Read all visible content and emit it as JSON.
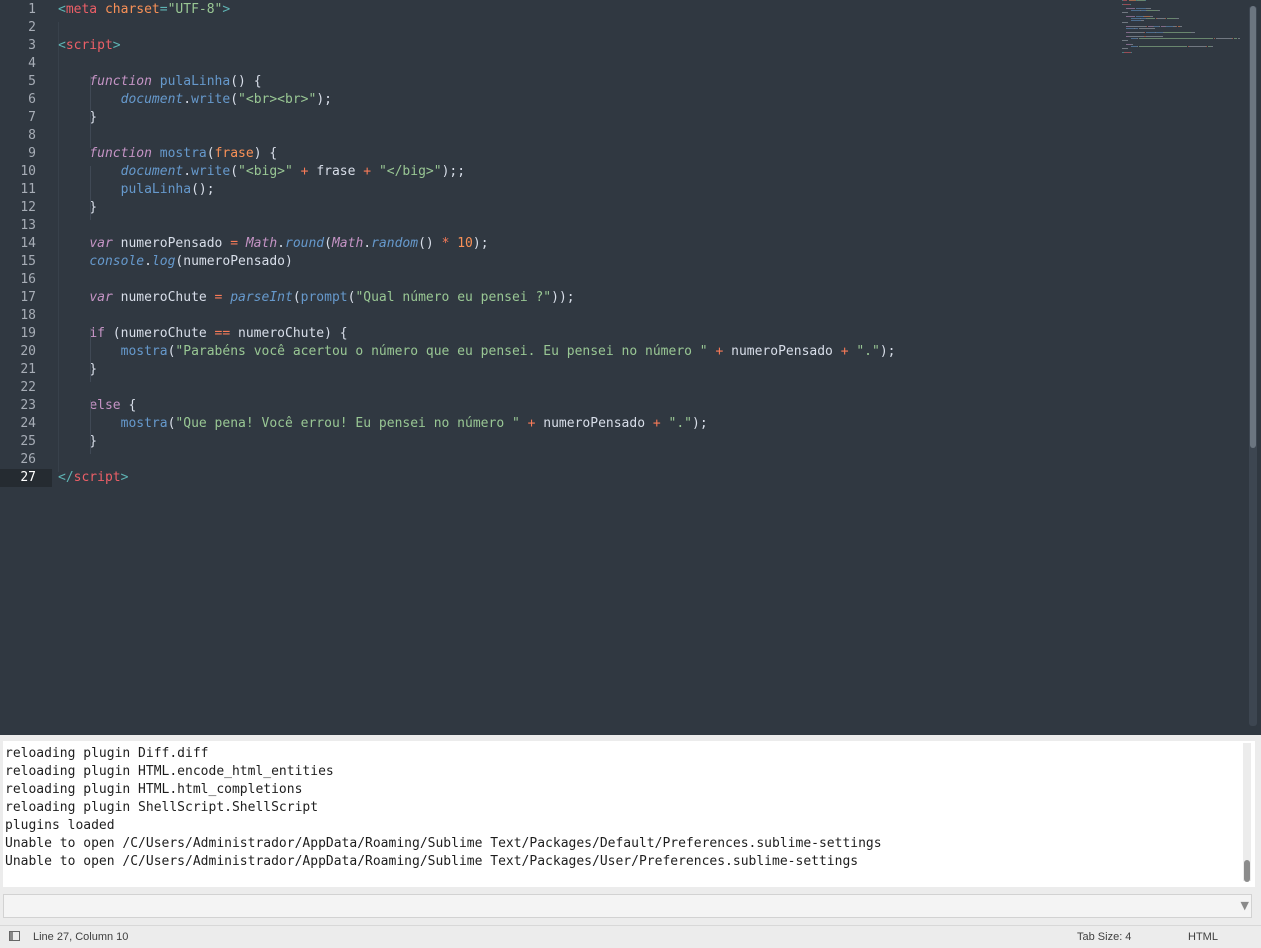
{
  "editor": {
    "current_line": 27,
    "lines": [
      [
        [
          "t-pun",
          "<"
        ],
        [
          "t-tag",
          "meta"
        ],
        [
          "t-def",
          " "
        ],
        [
          "t-att",
          "charset"
        ],
        [
          "t-pun",
          "="
        ],
        [
          "t-str",
          "\"UTF-8\""
        ],
        [
          "t-pun",
          ">"
        ]
      ],
      [],
      [
        [
          "t-pun",
          "<"
        ],
        [
          "t-tag",
          "script"
        ],
        [
          "t-pun",
          ">"
        ]
      ],
      [],
      [
        [
          "t-def",
          "    "
        ],
        [
          "t-kw",
          "function"
        ],
        [
          "t-def",
          " "
        ],
        [
          "t-fn",
          "pulaLinha"
        ],
        [
          "t-def",
          "() {"
        ]
      ],
      [
        [
          "t-def",
          "        "
        ],
        [
          "t-obj",
          "document"
        ],
        [
          "t-def",
          "."
        ],
        [
          "t-fn",
          "write"
        ],
        [
          "t-def",
          "("
        ],
        [
          "t-str",
          "\"<br><br>\""
        ],
        [
          "t-def",
          ");"
        ]
      ],
      [
        [
          "t-def",
          "    }"
        ]
      ],
      [],
      [
        [
          "t-def",
          "    "
        ],
        [
          "t-kw",
          "function"
        ],
        [
          "t-def",
          " "
        ],
        [
          "t-fn",
          "mostra"
        ],
        [
          "t-def",
          "("
        ],
        [
          "t-par",
          "frase"
        ],
        [
          "t-def",
          ") {"
        ]
      ],
      [
        [
          "t-def",
          "        "
        ],
        [
          "t-obj",
          "document"
        ],
        [
          "t-def",
          "."
        ],
        [
          "t-fn",
          "write"
        ],
        [
          "t-def",
          "("
        ],
        [
          "t-str",
          "\"<big>\""
        ],
        [
          "t-def",
          " "
        ],
        [
          "t-op",
          "+"
        ],
        [
          "t-def",
          " frase "
        ],
        [
          "t-op",
          "+"
        ],
        [
          "t-def",
          " "
        ],
        [
          "t-str",
          "\"</big>\""
        ],
        [
          "t-def",
          ");;"
        ]
      ],
      [
        [
          "t-def",
          "        "
        ],
        [
          "t-fn",
          "pulaLinha"
        ],
        [
          "t-def",
          "();"
        ]
      ],
      [
        [
          "t-def",
          "    }"
        ]
      ],
      [],
      [
        [
          "t-def",
          "    "
        ],
        [
          "t-kw",
          "var"
        ],
        [
          "t-def",
          " numeroPensado "
        ],
        [
          "t-op",
          "="
        ],
        [
          "t-def",
          " "
        ],
        [
          "t-cls",
          "Math"
        ],
        [
          "t-def",
          "."
        ],
        [
          "t-met",
          "round"
        ],
        [
          "t-def",
          "("
        ],
        [
          "t-cls",
          "Math"
        ],
        [
          "t-def",
          "."
        ],
        [
          "t-met",
          "random"
        ],
        [
          "t-def",
          "() "
        ],
        [
          "t-op",
          "*"
        ],
        [
          "t-def",
          " "
        ],
        [
          "t-num",
          "10"
        ],
        [
          "t-def",
          ");"
        ]
      ],
      [
        [
          "t-def",
          "    "
        ],
        [
          "t-obj",
          "console"
        ],
        [
          "t-def",
          "."
        ],
        [
          "t-met",
          "log"
        ],
        [
          "t-def",
          "(numeroPensado)"
        ]
      ],
      [],
      [
        [
          "t-def",
          "    "
        ],
        [
          "t-kw",
          "var"
        ],
        [
          "t-def",
          " numeroChute "
        ],
        [
          "t-op",
          "="
        ],
        [
          "t-def",
          " "
        ],
        [
          "t-met",
          "parseInt"
        ],
        [
          "t-def",
          "("
        ],
        [
          "t-fn",
          "prompt"
        ],
        [
          "t-def",
          "("
        ],
        [
          "t-str",
          "\"Qual número eu pensei ?\""
        ],
        [
          "t-def",
          "));"
        ]
      ],
      [],
      [
        [
          "t-def",
          "    "
        ],
        [
          "t-kwp",
          "if"
        ],
        [
          "t-def",
          " (numeroChute "
        ],
        [
          "t-op",
          "=="
        ],
        [
          "t-def",
          " numeroChute) {"
        ]
      ],
      [
        [
          "t-def",
          "        "
        ],
        [
          "t-fn",
          "mostra"
        ],
        [
          "t-def",
          "("
        ],
        [
          "t-str",
          "\"Parabéns você acertou o número que eu pensei. Eu pensei no número \""
        ],
        [
          "t-def",
          " "
        ],
        [
          "t-op",
          "+"
        ],
        [
          "t-def",
          " numeroPensado "
        ],
        [
          "t-op",
          "+"
        ],
        [
          "t-def",
          " "
        ],
        [
          "t-str",
          "\".\""
        ],
        [
          "t-def",
          ");"
        ]
      ],
      [
        [
          "t-def",
          "    }"
        ]
      ],
      [],
      [
        [
          "t-def",
          "    "
        ],
        [
          "t-kwp",
          "else"
        ],
        [
          "t-def",
          " {"
        ]
      ],
      [
        [
          "t-def",
          "        "
        ],
        [
          "t-fn",
          "mostra"
        ],
        [
          "t-def",
          "("
        ],
        [
          "t-str",
          "\"Que pena! Você errou! Eu pensei no número \""
        ],
        [
          "t-def",
          " "
        ],
        [
          "t-op",
          "+"
        ],
        [
          "t-def",
          " numeroPensado "
        ],
        [
          "t-op",
          "+"
        ],
        [
          "t-def",
          " "
        ],
        [
          "t-str",
          "\".\""
        ],
        [
          "t-def",
          ");"
        ]
      ],
      [
        [
          "t-def",
          "    }"
        ]
      ],
      [],
      [
        [
          "t-pun",
          "</"
        ],
        [
          "t-tag",
          "script"
        ],
        [
          "t-pun",
          ">"
        ]
      ]
    ]
  },
  "console": {
    "lines": [
      "reloading plugin Diff.diff",
      "reloading plugin HTML.encode_html_entities",
      "reloading plugin HTML.html_completions",
      "reloading plugin ShellScript.ShellScript",
      "plugins loaded",
      "Unable to open /C/Users/Administrador/AppData/Roaming/Sublime Text/Packages/Default/Preferences.sublime-settings",
      "Unable to open /C/Users/Administrador/AppData/Roaming/Sublime Text/Packages/User/Preferences.sublime-settings"
    ]
  },
  "command_input": {
    "value": "",
    "dropdown_icon": "chevron-down-icon"
  },
  "status_bar": {
    "position": "Line 27, Column 10",
    "tab_size": "Tab Size: 4",
    "syntax": "HTML",
    "panel_icon": "panel-toggle-icon"
  },
  "theme": {
    "editor_bg": "#303841",
    "string": "#99c794",
    "keyword": "#c594c5",
    "function": "#6699cc",
    "tag": "#ec5f67",
    "number": "#f99157"
  }
}
